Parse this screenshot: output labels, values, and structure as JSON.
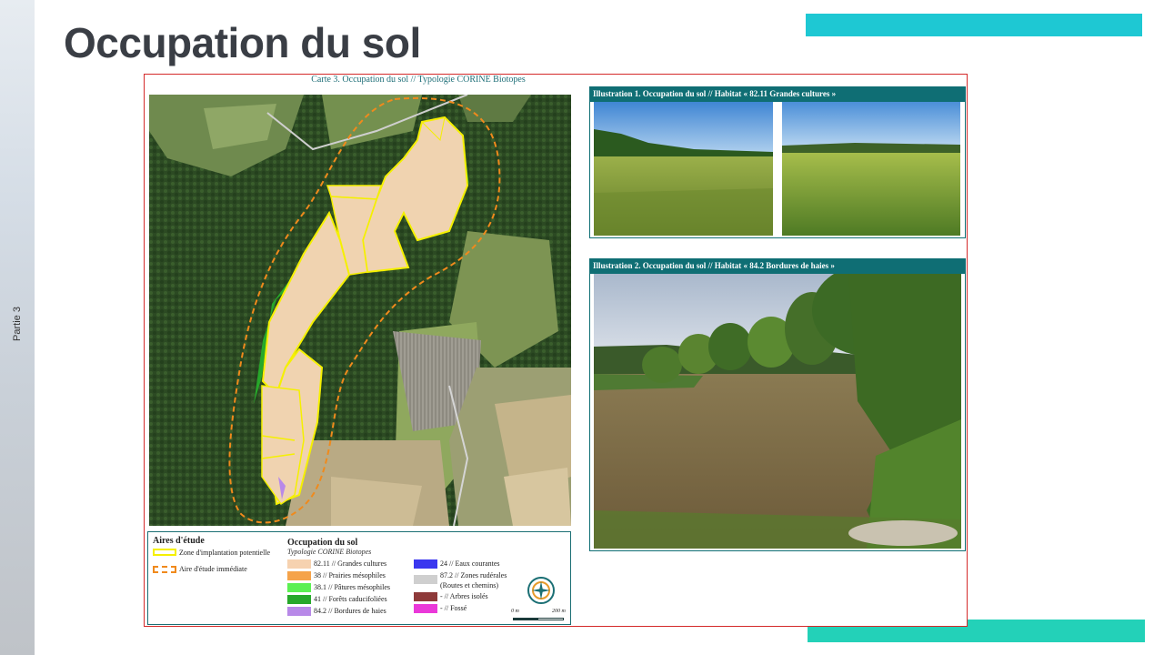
{
  "slide": {
    "title": "Occupation du sol",
    "side_label": "Partie 3",
    "accent_colors": {
      "top": "#1ec8d3",
      "bottom": "#23d1b8",
      "frame": "#d42a2a",
      "teal": "#0f6e74"
    }
  },
  "map": {
    "caption": "Carte 3.   Occupation du sol // Typologie CORINE Biotopes",
    "legend": {
      "study_title": "Aires d'étude",
      "study_items": [
        {
          "label": "Zone d'implantation potentielle",
          "color": "#f5f000",
          "style": "solid"
        },
        {
          "label": "Aire d'étude immédiate",
          "color": "#f08a1c",
          "style": "dashed"
        }
      ],
      "occupation_title": "Occupation du sol",
      "occupation_subtitle": "Typologie CORINE Biotopes",
      "occupation_items_col1": [
        {
          "label": "82.11 // Grandes cultures",
          "color": "#f6d2b0"
        },
        {
          "label": "38 // Prairies mésophiles",
          "color": "#f5a34a"
        },
        {
          "label": "38.1 // Pâtures mésophiles",
          "color": "#5cf052"
        },
        {
          "label": "41 // Forêts caducifoliées",
          "color": "#27a82a"
        },
        {
          "label": "84.2 // Bordures de haies",
          "color": "#b889e8"
        }
      ],
      "occupation_items_col2": [
        {
          "label": "24 // Eaux courantes",
          "color": "#3a37ef"
        },
        {
          "label": "87.2 // Zones rudérales",
          "color": "#cfcfcf"
        },
        {
          "label": "(Routes et chemins)",
          "color": ""
        },
        {
          "label": "- // Arbres isolés",
          "color": "#8e3a3a"
        },
        {
          "label": "- // Fossé",
          "color": "#ea38d9"
        }
      ],
      "scale_start": "0 m",
      "scale_end": "200 m"
    }
  },
  "illustrations": [
    {
      "caption": "Illustration 1.  Occupation du sol // Habitat « 82.11 Grandes cultures »",
      "icon": "field-photo-icon"
    },
    {
      "caption": "Illustration 2.  Occupation du sol // Habitat « 84.2 Bordures de haies »",
      "icon": "hedge-photo-icon"
    }
  ]
}
